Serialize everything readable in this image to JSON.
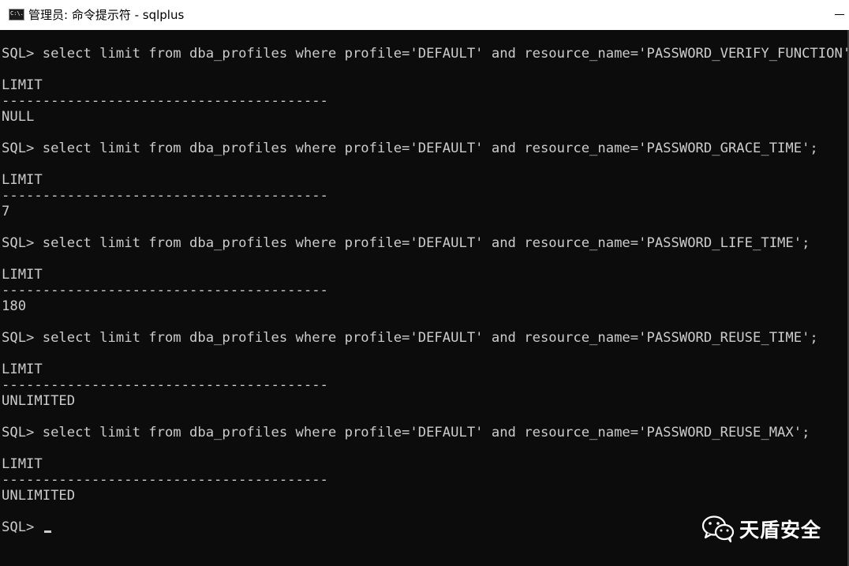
{
  "window": {
    "title": "管理员: 命令提示符 - sqlplus",
    "icon_label": "C:\\."
  },
  "console": {
    "lines": [
      "SQL> select limit from dba_profiles where profile='DEFAULT' and resource_name='PASSWORD_VERIFY_FUNCTION';",
      "",
      "LIMIT",
      "----------------------------------------",
      "NULL",
      "",
      "SQL> select limit from dba_profiles where profile='DEFAULT' and resource_name='PASSWORD_GRACE_TIME';",
      "",
      "LIMIT",
      "----------------------------------------",
      "7",
      "",
      "SQL> select limit from dba_profiles where profile='DEFAULT' and resource_name='PASSWORD_LIFE_TIME';",
      "",
      "LIMIT",
      "----------------------------------------",
      "180",
      "",
      "SQL> select limit from dba_profiles where profile='DEFAULT' and resource_name='PASSWORD_REUSE_TIME';",
      "",
      "LIMIT",
      "----------------------------------------",
      "UNLIMITED",
      "",
      "SQL> select limit from dba_profiles where profile='DEFAULT' and resource_name='PASSWORD_REUSE_MAX';",
      "",
      "LIMIT",
      "----------------------------------------",
      "UNLIMITED",
      "",
      "SQL> "
    ]
  },
  "watermark": {
    "text": "天盾安全",
    "icon": "wechat-icon"
  },
  "colors": {
    "console_bg": "#0c0c0c",
    "console_fg": "#cccccc",
    "titlebar_bg": "#ffffff"
  }
}
